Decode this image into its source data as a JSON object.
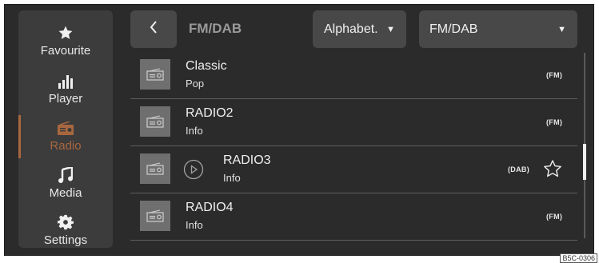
{
  "sidebar": {
    "items": [
      {
        "label": "Favourite",
        "icon": "star-icon"
      },
      {
        "label": "Player",
        "icon": "equalizer-icon"
      },
      {
        "label": "Radio",
        "icon": "radio-icon",
        "active": true
      },
      {
        "label": "Media",
        "icon": "music-note-icon"
      },
      {
        "label": "Settings",
        "icon": "gear-icon"
      }
    ]
  },
  "header": {
    "back_icon": "chevron-left-icon",
    "title": "FM/DAB",
    "sort_label": "Alphabet.",
    "band_label": "FM/DAB",
    "dropdown_icon": "caret-down-icon"
  },
  "stations": [
    {
      "name": "Classic",
      "info": "Pop",
      "band": "(FM)"
    },
    {
      "name": "RADIO2",
      "info": "Info",
      "band": "(FM)"
    },
    {
      "name": "RADIO3",
      "info": "Info",
      "band": "(DAB)",
      "playing": true,
      "favourite_icon": "star-outline-icon"
    },
    {
      "name": "RADIO4",
      "info": "Info",
      "band": "(FM)"
    }
  ],
  "figure_code": "B5C-0306",
  "colors": {
    "accent": "#a9673f",
    "background": "#2b2b2b",
    "panel": "#3c3c3c",
    "button": "#484848"
  }
}
